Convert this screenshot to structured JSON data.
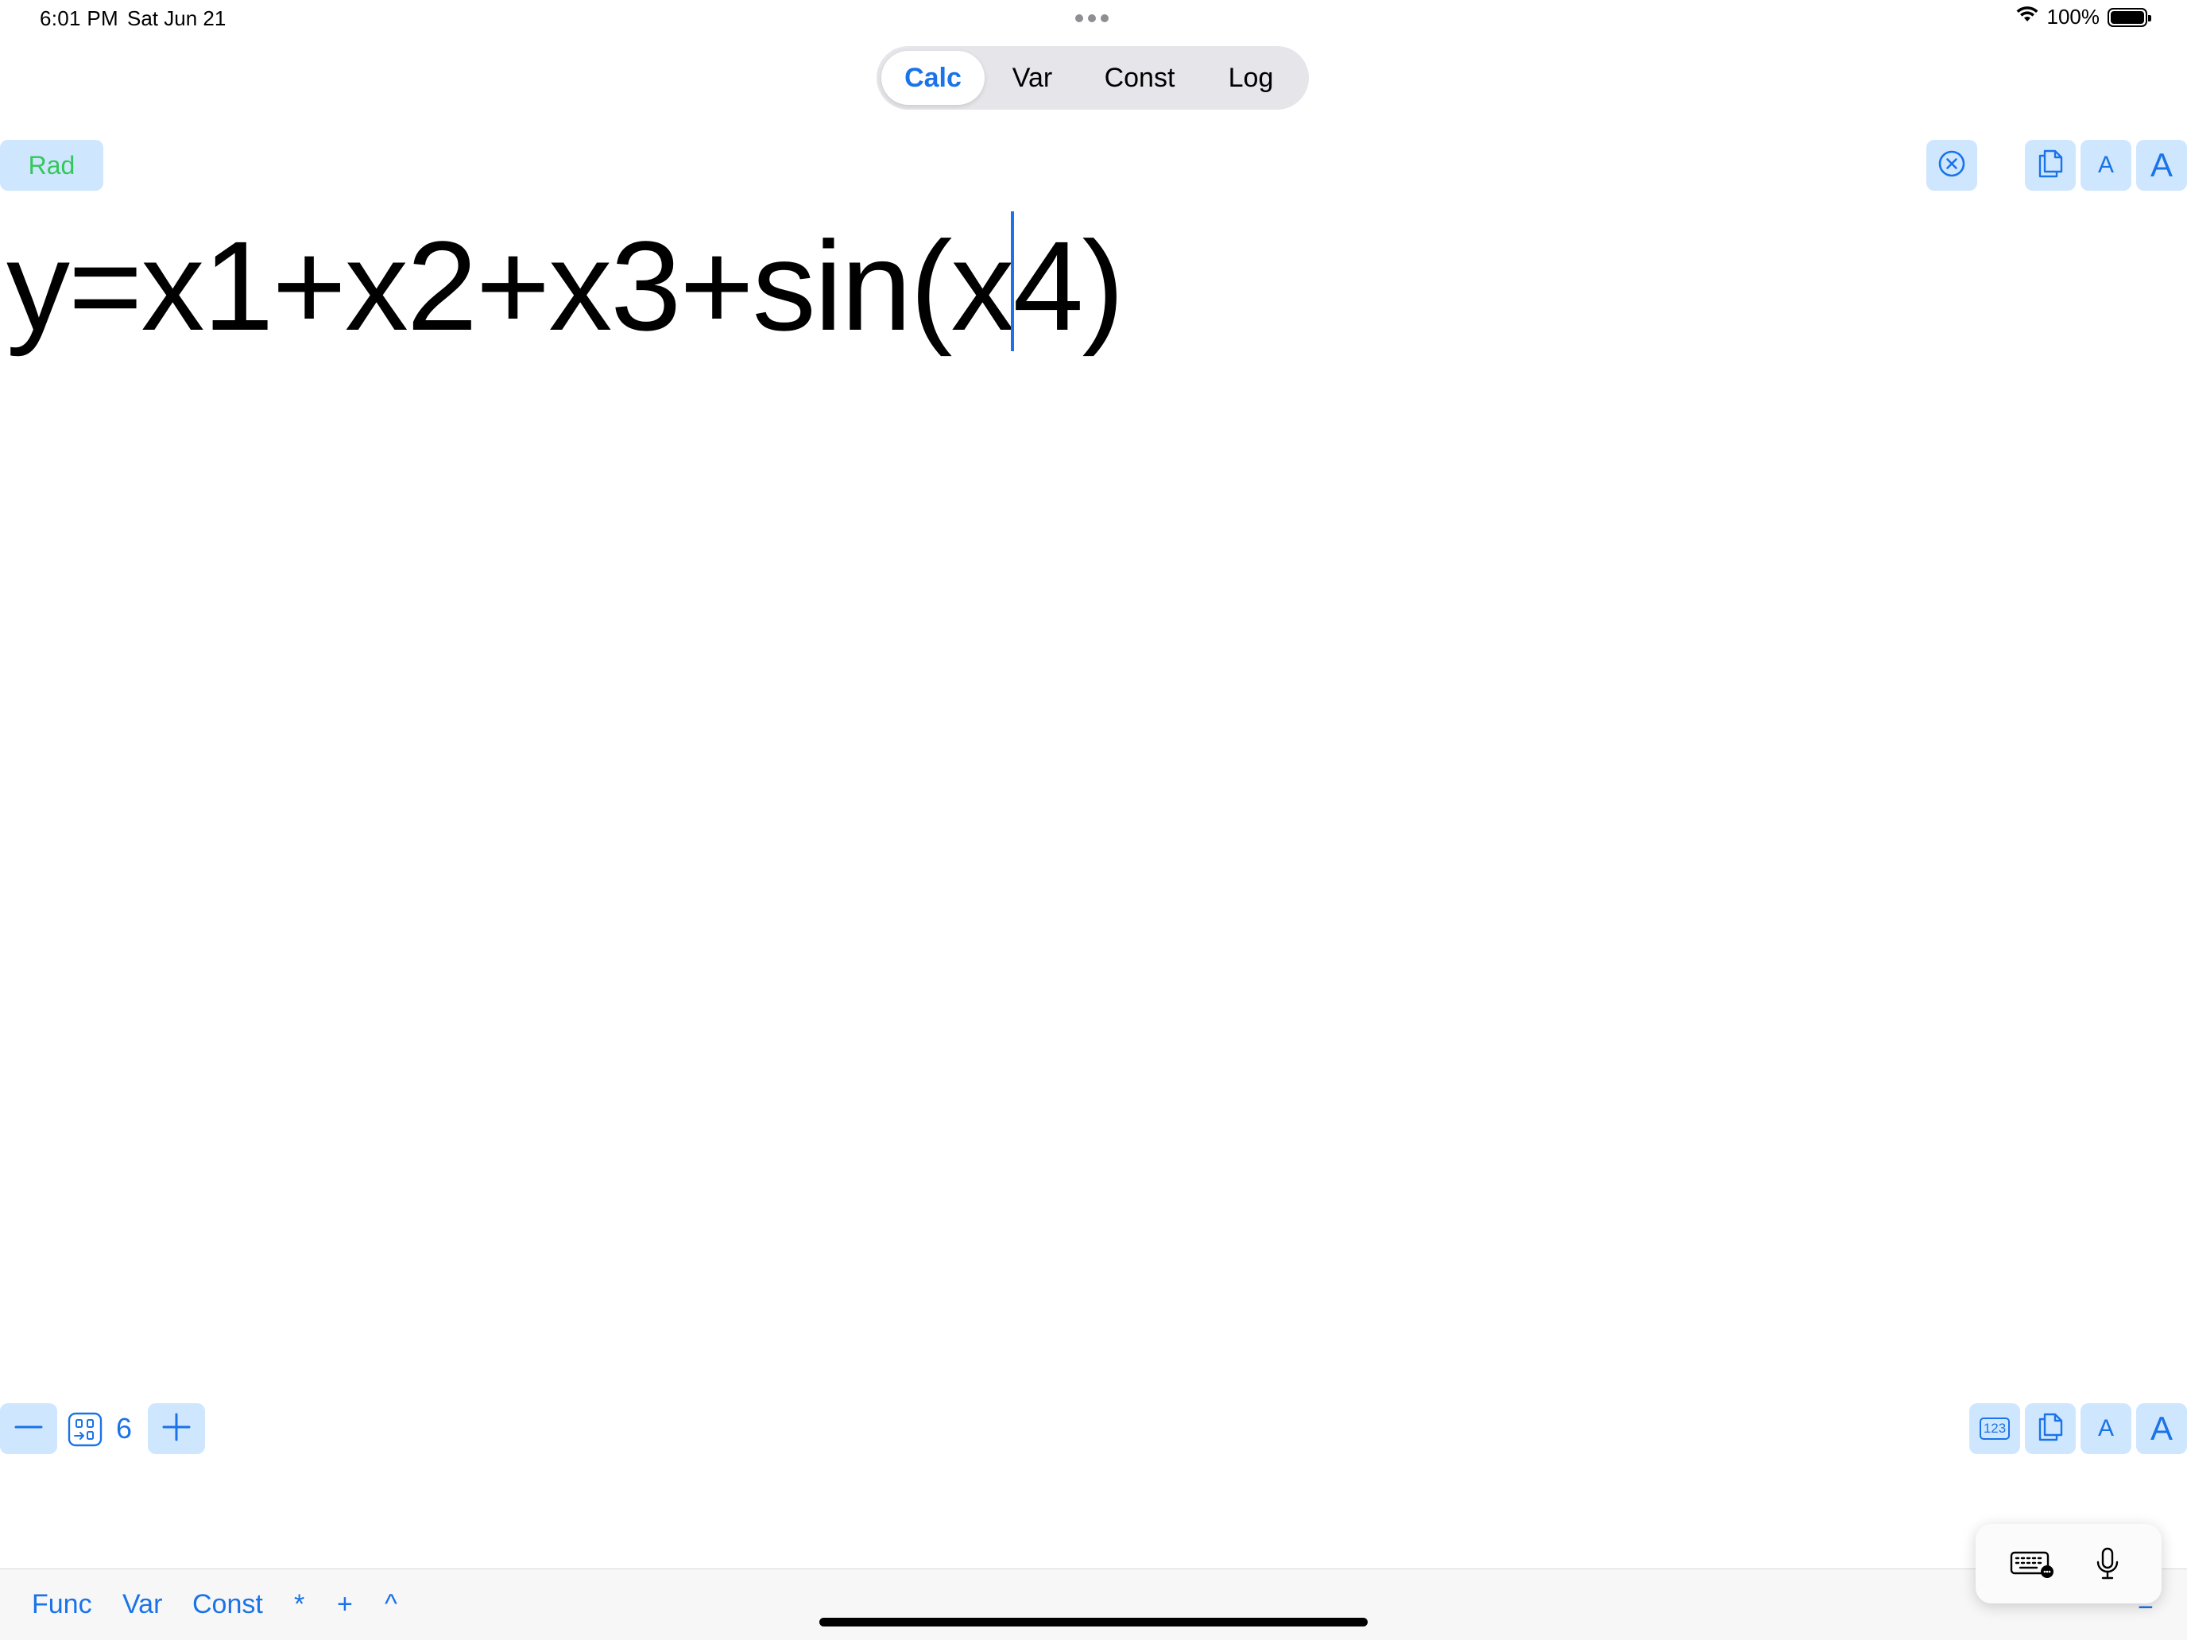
{
  "status_bar": {
    "time": "6:01 PM",
    "date": "Sat Jun 21",
    "battery": "100%"
  },
  "tabs": [
    {
      "label": "Calc",
      "active": true
    },
    {
      "label": "Var",
      "active": false
    },
    {
      "label": "Const",
      "active": false
    },
    {
      "label": "Log",
      "active": false
    }
  ],
  "toolbar": {
    "angle_mode": "Rad",
    "icons_top": [
      "clear-icon",
      "copy-icon",
      "font-small-icon",
      "font-large-icon"
    ],
    "font_small_label": "A",
    "font_large_label": "A"
  },
  "editor": {
    "expression": "y=x1+x2+x3+sin(x4)"
  },
  "precision": {
    "value": "6",
    "icons": [
      "minus-icon",
      "decimal-places-icon",
      "plus-icon"
    ]
  },
  "bottom_toolbar": {
    "icons": [
      "numeric-keypad-icon",
      "copy-icon",
      "font-small-icon",
      "font-large-icon"
    ],
    "keypad_label": "123",
    "font_small_label": "A",
    "font_large_label": "A"
  },
  "shortcut_bar": {
    "items": [
      "Func",
      "Var",
      "Const",
      "*",
      "+",
      "^"
    ],
    "equals": "="
  },
  "colors": {
    "accent": "#1a73e8",
    "button_bg": "#cfe6ff",
    "rad_green": "#34c759"
  }
}
